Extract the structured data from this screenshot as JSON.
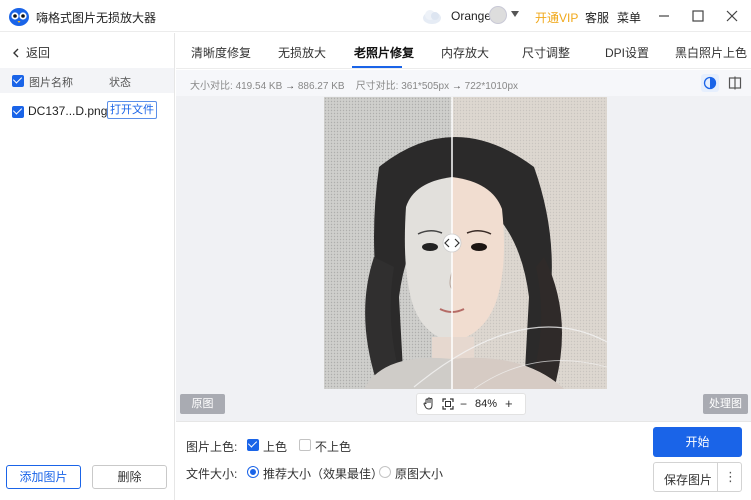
{
  "app": {
    "title": "嗨格式图片无损放大器",
    "user_name": "Orange",
    "vip_label": "开通VIP",
    "service_label": "客服",
    "menu_label": "菜单"
  },
  "colors": {
    "accent": "#1a64e8",
    "vip": "#f0a81a"
  },
  "sidebar": {
    "back_label": "返回",
    "col_name": "图片名称",
    "col_status": "状态",
    "files": [
      {
        "name": "DC137...D.png",
        "action": "打开文件",
        "checked": true
      }
    ],
    "add_label": "添加图片",
    "delete_label": "删除"
  },
  "tabs": [
    {
      "label": "清晰度修复",
      "active": false
    },
    {
      "label": "无损放大",
      "active": false
    },
    {
      "label": "老照片修复",
      "active": true
    },
    {
      "label": "内存放大",
      "active": false
    },
    {
      "label": "尺寸调整",
      "active": false
    },
    {
      "label": "DPI设置",
      "active": false
    },
    {
      "label": "黑白照片上色",
      "active": false
    }
  ],
  "info": {
    "size_label": "大小对比:",
    "size_before": "419.54 KB",
    "size_after": "886.27 KB",
    "dim_label": "尺寸对比:",
    "dim_before": "361*505px",
    "dim_after": "722*1010px",
    "arrow": "→"
  },
  "canvas": {
    "original_label": "原图",
    "processed_label": "处理图",
    "zoom": "84%",
    "zoom_minus": "−",
    "zoom_plus": "+"
  },
  "options": {
    "color_label": "图片上色:",
    "color_on": "上色",
    "color_off": "不上色",
    "color_selected": "上色",
    "filesize_label": "文件大小:",
    "filesize_recommended": "推荐大小（效果最佳）",
    "filesize_original": "原图大小",
    "filesize_selected": "推荐大小（效果最佳）"
  },
  "actions": {
    "start_label": "开始",
    "save_label": "保存图片",
    "more_label": "⋮"
  }
}
